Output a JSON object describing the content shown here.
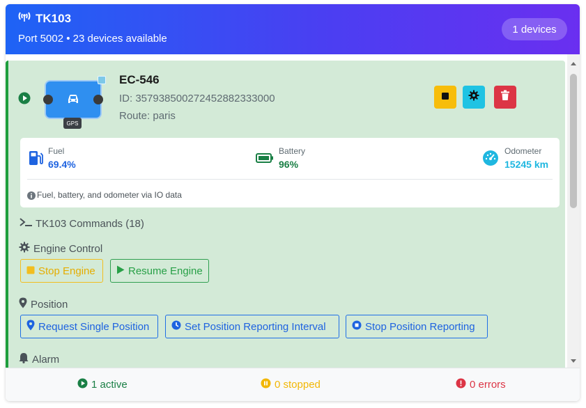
{
  "header": {
    "title": "TK103",
    "subtitle": "Port 5002 • 23 devices available",
    "badge": "1 devices",
    "icon": "antenna-icon"
  },
  "device": {
    "name": "EC-546",
    "id": "ID: 357938500272452882333000",
    "route": "Route: paris",
    "gps_tag": "GPS",
    "status_icon": "play-circle-icon"
  },
  "actions": {
    "stop_icon": "stop-icon",
    "settings_icon": "gear-icon",
    "delete_icon": "trash-icon",
    "colors": {
      "stop": "#f7bd0b",
      "settings": "#1fc3e3",
      "delete": "#dc3545"
    }
  },
  "stats": {
    "fuel": {
      "label": "Fuel",
      "value": "69.4%",
      "color": "#1e63e0"
    },
    "battery": {
      "label": "Battery",
      "value": "96%",
      "color": "#1a7f45"
    },
    "odometer": {
      "label": "Odometer",
      "value": "15245 km",
      "color": "#1fb7e0"
    },
    "note": "Fuel, battery, and odometer via IO data"
  },
  "commands": {
    "header": "TK103 Commands (18)",
    "engine": {
      "title": "Engine Control",
      "stop": "Stop Engine",
      "resume": "Resume Engine"
    },
    "position": {
      "title": "Position",
      "request": "Request Single Position",
      "interval": "Set Position Reporting Interval",
      "stop": "Stop Position Reporting"
    },
    "alarm": {
      "title": "Alarm"
    }
  },
  "footer": {
    "active": "1 active",
    "stopped": "0 stopped",
    "errors": "0 errors",
    "colors": {
      "active": "#1a7f45",
      "stopped": "#f2b705",
      "errors": "#dc3545"
    }
  }
}
